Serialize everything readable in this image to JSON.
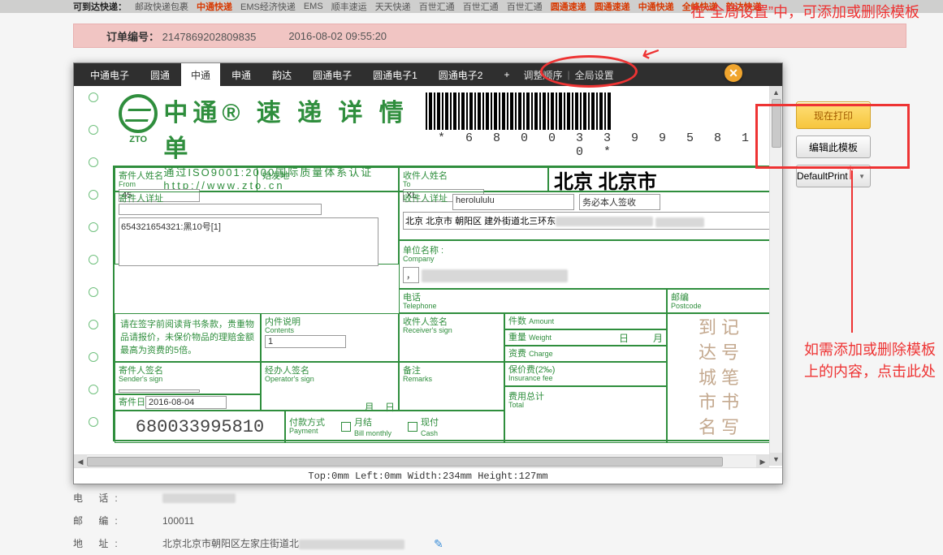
{
  "header": {
    "label": "可到达快递：",
    "items": [
      "邮政快递包裹",
      "中通快递",
      "EMS经济快递",
      "EMS",
      "顺丰速运",
      "天天快递",
      "百世汇通",
      "百世汇通",
      "百世汇通",
      "圆通速递",
      "圆通速递",
      "中通快递",
      "全峰快递",
      "韵达快递"
    ]
  },
  "order_bar": {
    "label": "订单编号：",
    "order_no": "2147869202809835",
    "datetime": "2016-08-02 09:55:20"
  },
  "tabs": {
    "items": [
      "中通电子",
      "圆通",
      "中通",
      "申通",
      "韵达",
      "圆通电子",
      "圆通电子1",
      "圆通电子2"
    ],
    "active_index": 2,
    "add": "+",
    "sort_link": "调整顺序",
    "global_link": "全局设置"
  },
  "waybill": {
    "header": {
      "zto": "ZTO",
      "title": "中通® 速 递 详 情 单",
      "sub1": "通过ISO9001:2000国际质量体系认证",
      "sub2": "http://www.zto.cn",
      "barcode_num": "* 6 8 0 0 3 3 9 9 5 8 1 0 *"
    },
    "labels": {
      "from_name": "寄件人姓名",
      "from_name_en": "From",
      "origin": "始发地",
      "from_addr": "寄件人详址",
      "to_name": "收件人姓名",
      "to_name_en": "To",
      "to_addr": "收件人详址",
      "company": "单位名称",
      "company_en": "Company",
      "phone": "电话",
      "phone_en": "Telephone",
      "postcode": "邮编",
      "postcode_en": "Postcode",
      "declaration": "请在签字前阅读背书条款，贵重物品请报价，未保价物品的理赔金额最高为资费的5倍。",
      "contents": "内件说明",
      "contents_en": "Contents",
      "rcvsign": "收件人签名",
      "rcvsign_en": "Receiver's sign",
      "amount": "件数",
      "amount_en": "Amount",
      "weight": "重量",
      "weight_en": "Weight",
      "charge": "资费",
      "charge_en": "Charge",
      "insurance": "保价费(2‰)",
      "insurance_en": "Insurance fee",
      "sendersign": "寄件人签名",
      "sendersign_en": "Sender's sign",
      "opsign": "经办人签名",
      "opsign_en": "Operator's sign",
      "remarks": "备注",
      "remarks_en": "Remarks",
      "senddate": "寄件日",
      "pay": "付款方式",
      "pay_en": "Payment",
      "monthly": "月结",
      "monthly_en": "Bill monthly",
      "cash": "现付",
      "cash_en": "Cash",
      "total": "费用总计",
      "total_en": "Total",
      "md1": "月",
      "md2": "日",
      "stamp": "到 达\n城 市\n记 号\n笔 书\n写 名"
    },
    "values": {
      "from_name": "45",
      "items_desc": "654321654321:黑10号[1]",
      "to_name": "XL",
      "dest": "北京  北京市",
      "to_contact": "herolululu",
      "sign_note": "务必本人签收",
      "to_addr_prefix": "北京  北京市  朝阳区  建外街道北三环东",
      "company_val": "，",
      "contents": "1",
      "sender_sign": "",
      "send_date": "2016-08-04",
      "tracking": "680033995810"
    },
    "status": "Top:0mm   Left:0mm   Width:234mm   Height:127mm"
  },
  "right_panel": {
    "print_now": "现在打印",
    "edit_tpl": "编辑此模板",
    "printer": "DefaultPrint"
  },
  "annotations": {
    "top": "在“全局设置”中，可添加或删除模板",
    "right": "如需添加或删除模板上的内容，点击此处"
  },
  "details": {
    "phone_lbl": "电 话:",
    "post_lbl": "邮 编:",
    "addr_lbl": "地 址:",
    "post_val": "100011",
    "addr_val_prefix": "北京北京市朝阳区左家庄街道北"
  }
}
